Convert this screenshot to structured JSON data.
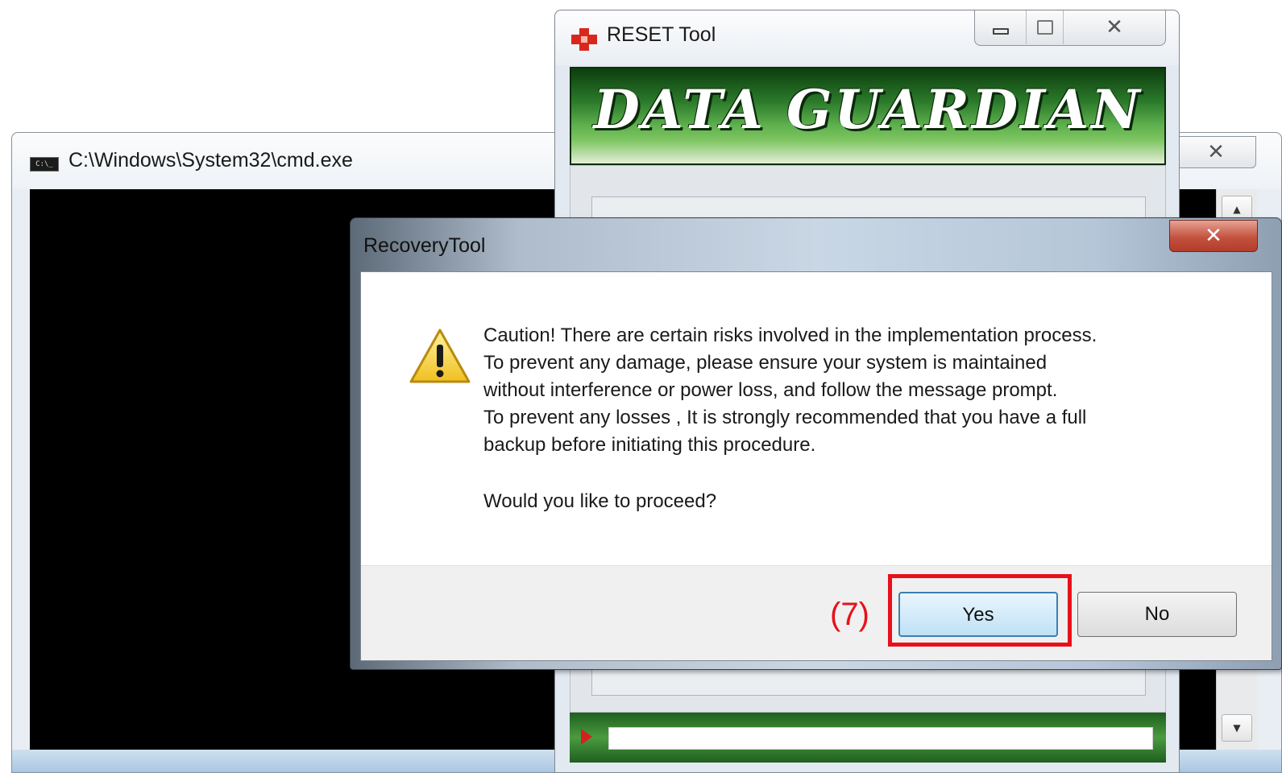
{
  "cmd_window": {
    "title": "C:\\Windows\\System32\\cmd.exe",
    "icon": "console-icon",
    "close_glyph": "✕"
  },
  "reset_window": {
    "title": "RESET Tool",
    "icon": "red-cross-icon",
    "banner_text": "DATA GUARDIAN",
    "close_glyph": "✕"
  },
  "dialog": {
    "title": "RecoveryTool",
    "close_glyph": "✕",
    "icon": "warning-icon",
    "message_lines": [
      "Caution! There are certain risks involved in the implementation process.",
      "To prevent any damage, please ensure your system is maintained",
      "without interference or power loss, and follow the message prompt.",
      "To prevent any losses , It is strongly recommended that you have a full",
      "backup before initiating this procedure."
    ],
    "question": "Would you like to proceed?",
    "yes_label": "Yes",
    "no_label": "No"
  },
  "annotation": {
    "label": "(7)",
    "color": "#e8101a"
  },
  "colors": {
    "banner_green": "#2b7a2b",
    "warning_yellow": "#f6d44a",
    "close_red": "#c4523f",
    "default_button_blue": "#3c7fb1"
  }
}
